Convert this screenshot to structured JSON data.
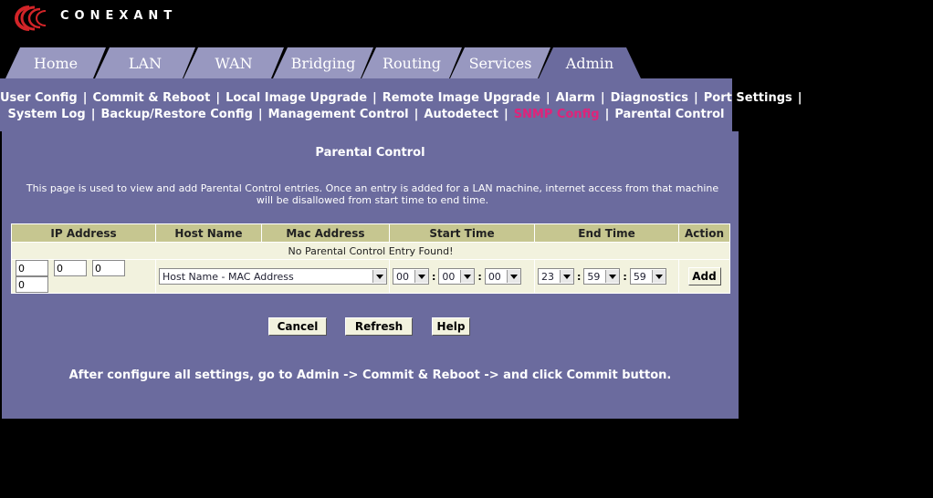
{
  "brand": {
    "name": "CONEXANT",
    "logo_color": "#D22428"
  },
  "tabs": [
    {
      "label": "Home",
      "active": false
    },
    {
      "label": "LAN",
      "active": false
    },
    {
      "label": "WAN",
      "active": false
    },
    {
      "label": "Bridging",
      "active": false
    },
    {
      "label": "Routing",
      "active": false
    },
    {
      "label": "Services",
      "active": false
    },
    {
      "label": "Admin",
      "active": true
    }
  ],
  "submenu": {
    "row1": [
      "User Config",
      "Commit & Reboot",
      "Local Image Upgrade",
      "Remote Image Upgrade",
      "Alarm",
      "Diagnostics",
      "Port Settings"
    ],
    "row2": [
      "System Log",
      "Backup/Restore Config",
      "Management Control",
      "Autodetect",
      "SNMP Config",
      "Parental Control"
    ],
    "highlight": "SNMP Config"
  },
  "page": {
    "title": "Parental Control",
    "description_1": "This page is used to view and add Parental Control entries. Once an entry is added for a LAN machine, internet access from that machine",
    "description_2": "will be disallowed from start time to end time."
  },
  "table": {
    "headers": {
      "ip": "IP Address",
      "host": "Host Name",
      "mac": "Mac Address",
      "start": "Start Time",
      "end": "End Time",
      "action": "Action"
    },
    "empty_message": "No Parental Control Entry Found!",
    "ip": [
      "0",
      "0",
      "0",
      "0"
    ],
    "host_select": "Host Name - MAC Address",
    "start": [
      "00",
      "00",
      "00"
    ],
    "end": [
      "23",
      "59",
      "59"
    ],
    "add_label": "Add"
  },
  "buttons": {
    "cancel": "Cancel",
    "refresh": "Refresh",
    "help": "Help"
  },
  "footer_note": "After configure all settings, go to Admin -> Commit & Reboot -> and click Commit button.",
  "colors": {
    "panel": "#6B6B9E",
    "tab_inactive": "#9898C0",
    "tab_active": "#6B6B9E",
    "header_cell": "#C6C690",
    "cell": "#F2F2DE",
    "highlight": "#E0237A"
  }
}
